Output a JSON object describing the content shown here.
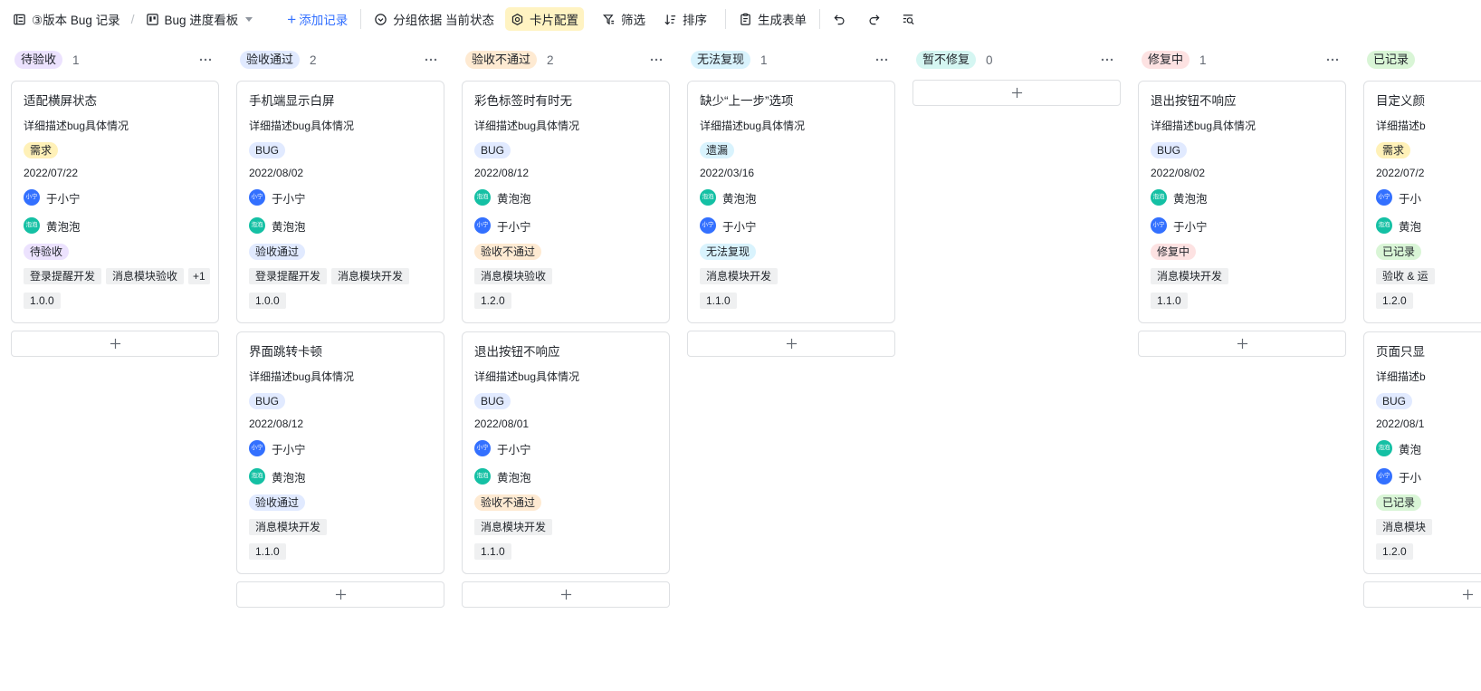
{
  "toolbar": {
    "table_name": "③版本 Bug 记录",
    "view_name": "Bug 进度看板",
    "add_record": "添加记录",
    "group_by": "分组依据 当前状态",
    "card_config": "卡片配置",
    "filter": "筛选",
    "sort": "排序",
    "generate_form": "生成表单"
  },
  "colors": {
    "accent": "#3370ff",
    "avatar_yu": "#3370ff",
    "avatar_huang": "#14c0a4",
    "active_tool_bg": "#fff3c2"
  },
  "columns": [
    {
      "id": "pending",
      "title": "待验收",
      "count": "1",
      "theme": "purple",
      "cards": [
        {
          "title": "适配横屏状态",
          "desc": "详细描述bug具体情况",
          "type": "需求",
          "type_theme": "yellow",
          "date": "2022/07/22",
          "people": [
            {
              "avatar": "小宁",
              "name": "于小宁",
              "color": "#3370ff"
            },
            {
              "avatar": "泡泡",
              "name": "黄泡泡",
              "color": "#14c0a4"
            }
          ],
          "status": "待验收",
          "status_theme": "purple",
          "modules": [
            "登录提醒开发",
            "消息模块验收"
          ],
          "modules_more": "+1",
          "version": "1.0.0"
        }
      ]
    },
    {
      "id": "passed",
      "title": "验收通过",
      "count": "2",
      "theme": "blue",
      "cards": [
        {
          "title": "手机端显示白屏",
          "desc": "详细描述bug具体情况",
          "type": "BUG",
          "type_theme": "blue",
          "date": "2022/08/02",
          "people": [
            {
              "avatar": "小宁",
              "name": "于小宁",
              "color": "#3370ff"
            },
            {
              "avatar": "泡泡",
              "name": "黄泡泡",
              "color": "#14c0a4"
            }
          ],
          "status": "验收通过",
          "status_theme": "blue",
          "modules": [
            "登录提醒开发",
            "消息模块开发"
          ],
          "version": "1.0.0"
        },
        {
          "title": "界面跳转卡顿",
          "desc": "详细描述bug具体情况",
          "type": "BUG",
          "type_theme": "blue",
          "date": "2022/08/12",
          "people": [
            {
              "avatar": "小宁",
              "name": "于小宁",
              "color": "#3370ff"
            },
            {
              "avatar": "泡泡",
              "name": "黄泡泡",
              "color": "#14c0a4"
            }
          ],
          "status": "验收通过",
          "status_theme": "blue",
          "modules": [
            "消息模块开发"
          ],
          "version": "1.1.0"
        }
      ]
    },
    {
      "id": "failed",
      "title": "验收不通过",
      "count": "2",
      "theme": "orange",
      "cards": [
        {
          "title": "彩色标签时有时无",
          "desc": "详细描述bug具体情况",
          "type": "BUG",
          "type_theme": "blue",
          "date": "2022/08/12",
          "people": [
            {
              "avatar": "泡泡",
              "name": "黄泡泡",
              "color": "#14c0a4"
            },
            {
              "avatar": "小宁",
              "name": "于小宁",
              "color": "#3370ff"
            }
          ],
          "status": "验收不通过",
          "status_theme": "orange",
          "modules": [
            "消息模块验收"
          ],
          "version": "1.2.0"
        },
        {
          "title": "退出按钮不响应",
          "desc": "详细描述bug具体情况",
          "type": "BUG",
          "type_theme": "blue",
          "date": "2022/08/01",
          "people": [
            {
              "avatar": "小宁",
              "name": "于小宁",
              "color": "#3370ff"
            },
            {
              "avatar": "泡泡",
              "name": "黄泡泡",
              "color": "#14c0a4"
            }
          ],
          "status": "验收不通过",
          "status_theme": "orange",
          "modules": [
            "消息模块开发"
          ],
          "version": "1.1.0"
        }
      ]
    },
    {
      "id": "cannot-reproduce",
      "title": "无法复现",
      "count": "1",
      "theme": "cyan",
      "cards": [
        {
          "title": "缺少“上一步”选项",
          "desc": "详细描述bug具体情况",
          "type": "遗漏",
          "type_theme": "cyan",
          "date": "2022/03/16",
          "people": [
            {
              "avatar": "泡泡",
              "name": "黄泡泡",
              "color": "#14c0a4"
            },
            {
              "avatar": "小宁",
              "name": "于小宁",
              "color": "#3370ff"
            }
          ],
          "status": "无法复现",
          "status_theme": "cyan",
          "modules": [
            "消息模块开发"
          ],
          "version": "1.1.0"
        }
      ]
    },
    {
      "id": "wont-fix",
      "title": "暂不修复",
      "count": "0",
      "theme": "teal",
      "cards": []
    },
    {
      "id": "fixing",
      "title": "修复中",
      "count": "1",
      "theme": "red",
      "cards": [
        {
          "title": "退出按钮不响应",
          "desc": "详细描述bug具体情况",
          "type": "BUG",
          "type_theme": "blue",
          "date": "2022/08/02",
          "people": [
            {
              "avatar": "泡泡",
              "name": "黄泡泡",
              "color": "#14c0a4"
            },
            {
              "avatar": "小宁",
              "name": "于小宁",
              "color": "#3370ff"
            }
          ],
          "status": "修复中",
          "status_theme": "red",
          "modules": [
            "消息模块开发"
          ],
          "version": "1.1.0"
        }
      ]
    },
    {
      "id": "recorded",
      "title": "已记录",
      "count": "",
      "theme": "green",
      "cards": [
        {
          "title": "目定义颜",
          "desc": "详细描述b",
          "type": "需求",
          "type_theme": "yellow",
          "date": "2022/07/2",
          "people": [
            {
              "avatar": "小宁",
              "name": "于小",
              "color": "#3370ff"
            },
            {
              "avatar": "泡泡",
              "name": "黄泡",
              "color": "#14c0a4"
            }
          ],
          "status": "已记录",
          "status_theme": "green",
          "modules": [
            "验收 & 运"
          ],
          "version": "1.2.0"
        },
        {
          "title": "页面只显",
          "desc": "详细描述b",
          "type": "BUG",
          "type_theme": "blue",
          "date": "2022/08/1",
          "people": [
            {
              "avatar": "泡泡",
              "name": "黄泡",
              "color": "#14c0a4"
            },
            {
              "avatar": "小宁",
              "name": "于小",
              "color": "#3370ff"
            }
          ],
          "status": "已记录",
          "status_theme": "green",
          "modules": [
            "消息模块"
          ],
          "version": "1.2.0"
        }
      ]
    }
  ]
}
